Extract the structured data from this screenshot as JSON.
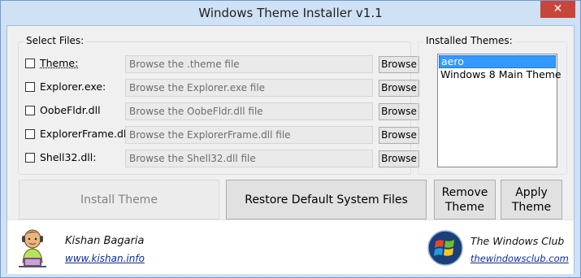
{
  "window": {
    "title": "Windows Theme Installer v1.1",
    "close_glyph": "✕"
  },
  "select_files": {
    "label": "Select Files:",
    "browse_label": "Browse",
    "rows": [
      {
        "label": "Theme:",
        "placeholder": "Browse the .theme file",
        "checked": false
      },
      {
        "label": "Explorer.exe:",
        "placeholder": "Browse the Explorer.exe file",
        "checked": false
      },
      {
        "label": "OobeFldr.dll",
        "placeholder": "Browse the OobeFldr.dll file",
        "checked": false
      },
      {
        "label": "ExplorerFrame.dll:",
        "placeholder": "Browse the ExplorerFrame.dll file",
        "checked": false
      },
      {
        "label": "Shell32.dll:",
        "placeholder": "Browse the Shell32.dll file",
        "checked": false
      }
    ]
  },
  "installed_themes": {
    "label": "Installed Themes:",
    "items": [
      "aero",
      "Windows 8 Main Theme"
    ],
    "selected": "aero"
  },
  "actions": {
    "install": "Install Theme",
    "restore": "Restore Default System Files",
    "remove_line1": "Remove",
    "remove_line2": "Theme",
    "apply_line1": "Apply",
    "apply_line2": "Theme"
  },
  "footer": {
    "author_name": "Kishan Bagaria",
    "author_link": "www.kishan.info",
    "club_name": "The Windows Club",
    "club_link": "thewindowsclub.com"
  },
  "colors": {
    "title_bar": "#cfe1f4",
    "close_button": "#c7453a",
    "selection": "#3399ff",
    "link": "#0b2ba0"
  }
}
